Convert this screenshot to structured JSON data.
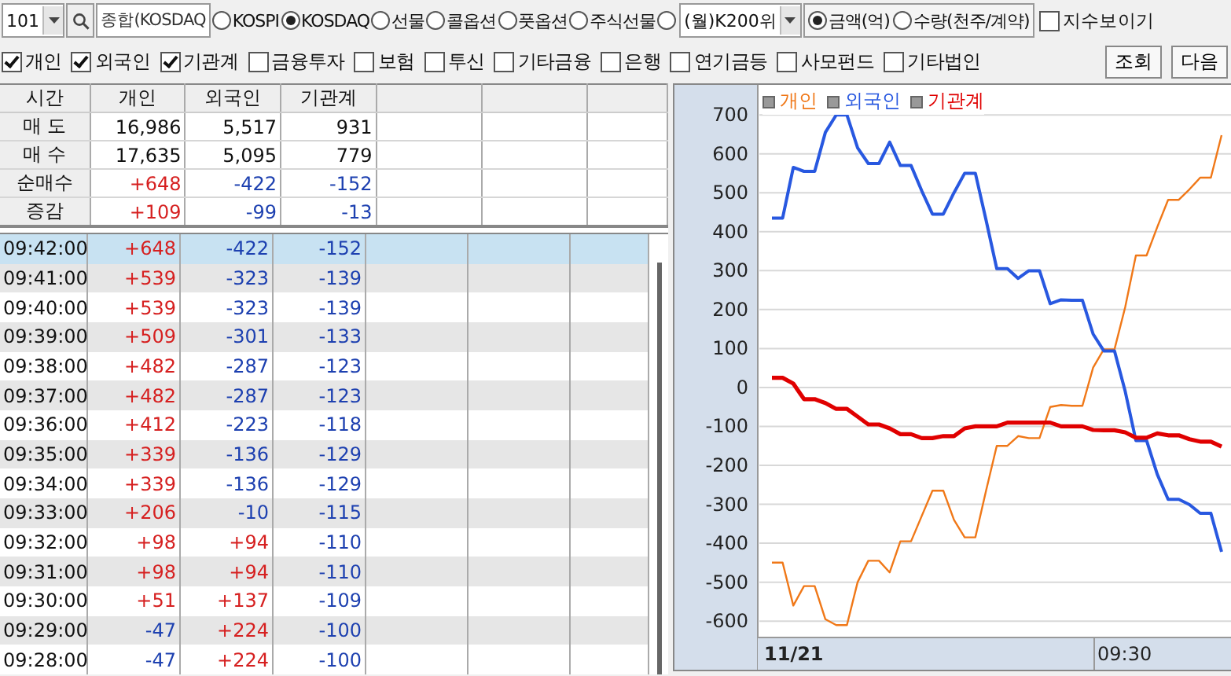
{
  "toolbar": {
    "code": "101",
    "market_field": "종합(KOSDAQ",
    "markets": [
      {
        "label": "KOSPI",
        "selected": false
      },
      {
        "label": "KOSDAQ",
        "selected": true
      },
      {
        "label": "선물",
        "selected": false
      },
      {
        "label": "콜옵션",
        "selected": false
      },
      {
        "label": "풋옵션",
        "selected": false
      },
      {
        "label": "주식선물",
        "selected": false
      },
      {
        "selected": false
      }
    ],
    "weekly_dropdown": "(월)K200위",
    "units": [
      {
        "label": "금액(억)",
        "selected": true
      },
      {
        "label": "수량(천주/계약)",
        "selected": false
      }
    ],
    "show_index": {
      "label": "지수보이기",
      "checked": false
    }
  },
  "filters": [
    {
      "label": "개인",
      "checked": true
    },
    {
      "label": "외국인",
      "checked": true
    },
    {
      "label": "기관계",
      "checked": true
    },
    {
      "label": "금융투자",
      "checked": false
    },
    {
      "label": "보험",
      "checked": false
    },
    {
      "label": "투신",
      "checked": false
    },
    {
      "label": "기타금융",
      "checked": false
    },
    {
      "label": "은행",
      "checked": false
    },
    {
      "label": "연기금등",
      "checked": false
    },
    {
      "label": "사모펀드",
      "checked": false
    },
    {
      "label": "기타법인",
      "checked": false
    }
  ],
  "buttons": [
    "조회",
    "다음"
  ],
  "summary": {
    "columns": [
      "시간",
      "개인",
      "외국인",
      "기관계"
    ],
    "rows": [
      {
        "cells": [
          {
            "text": "매 도",
            "color": "#111111"
          },
          {
            "text": "16,986",
            "color": "#111111"
          },
          {
            "text": "5,517",
            "color": "#111111"
          },
          {
            "text": "931",
            "color": "#111111"
          }
        ]
      },
      {
        "cells": [
          {
            "text": "매 수",
            "color": "#111111"
          },
          {
            "text": "17,635",
            "color": "#111111"
          },
          {
            "text": "5,095",
            "color": "#111111"
          },
          {
            "text": "779",
            "color": "#111111"
          }
        ]
      },
      {
        "cells": [
          {
            "text": "순매수",
            "color": "#111111"
          },
          {
            "text": "+648",
            "color": "#d62020"
          },
          {
            "text": "-422",
            "color": "#1d40b0"
          },
          {
            "text": "-152",
            "color": "#1d40b0"
          }
        ]
      },
      {
        "cells": [
          {
            "text": "증감",
            "color": "#111111"
          },
          {
            "text": "+109",
            "color": "#d62020"
          },
          {
            "text": "-99",
            "color": "#1d40b0"
          },
          {
            "text": "-13",
            "color": "#1d40b0"
          }
        ]
      }
    ]
  },
  "grid_rows": [
    {
      "selected": true,
      "cells": [
        {
          "text": "09:42:00",
          "color": "#111111"
        },
        {
          "text": "+648",
          "color": "#d62020"
        },
        {
          "text": "-422",
          "color": "#1d40b0"
        },
        {
          "text": "-152",
          "color": "#1d40b0"
        }
      ]
    },
    {
      "selected": false,
      "cells": [
        {
          "text": "09:41:00",
          "color": "#111111"
        },
        {
          "text": "+539",
          "color": "#d62020"
        },
        {
          "text": "-323",
          "color": "#1d40b0"
        },
        {
          "text": "-139",
          "color": "#1d40b0"
        }
      ]
    },
    {
      "selected": false,
      "cells": [
        {
          "text": "09:40:00",
          "color": "#111111"
        },
        {
          "text": "+539",
          "color": "#d62020"
        },
        {
          "text": "-323",
          "color": "#1d40b0"
        },
        {
          "text": "-139",
          "color": "#1d40b0"
        }
      ]
    },
    {
      "selected": false,
      "cells": [
        {
          "text": "09:39:00",
          "color": "#111111"
        },
        {
          "text": "+509",
          "color": "#d62020"
        },
        {
          "text": "-301",
          "color": "#1d40b0"
        },
        {
          "text": "-133",
          "color": "#1d40b0"
        }
      ]
    },
    {
      "selected": false,
      "cells": [
        {
          "text": "09:38:00",
          "color": "#111111"
        },
        {
          "text": "+482",
          "color": "#d62020"
        },
        {
          "text": "-287",
          "color": "#1d40b0"
        },
        {
          "text": "-123",
          "color": "#1d40b0"
        }
      ]
    },
    {
      "selected": false,
      "cells": [
        {
          "text": "09:37:00",
          "color": "#111111"
        },
        {
          "text": "+482",
          "color": "#d62020"
        },
        {
          "text": "-287",
          "color": "#1d40b0"
        },
        {
          "text": "-123",
          "color": "#1d40b0"
        }
      ]
    },
    {
      "selected": false,
      "cells": [
        {
          "text": "09:36:00",
          "color": "#111111"
        },
        {
          "text": "+412",
          "color": "#d62020"
        },
        {
          "text": "-223",
          "color": "#1d40b0"
        },
        {
          "text": "-118",
          "color": "#1d40b0"
        }
      ]
    },
    {
      "selected": false,
      "cells": [
        {
          "text": "09:35:00",
          "color": "#111111"
        },
        {
          "text": "+339",
          "color": "#d62020"
        },
        {
          "text": "-136",
          "color": "#1d40b0"
        },
        {
          "text": "-129",
          "color": "#1d40b0"
        }
      ]
    },
    {
      "selected": false,
      "cells": [
        {
          "text": "09:34:00",
          "color": "#111111"
        },
        {
          "text": "+339",
          "color": "#d62020"
        },
        {
          "text": "-136",
          "color": "#1d40b0"
        },
        {
          "text": "-129",
          "color": "#1d40b0"
        }
      ]
    },
    {
      "selected": false,
      "cells": [
        {
          "text": "09:33:00",
          "color": "#111111"
        },
        {
          "text": "+206",
          "color": "#d62020"
        },
        {
          "text": "-10",
          "color": "#1d40b0"
        },
        {
          "text": "-115",
          "color": "#1d40b0"
        }
      ]
    },
    {
      "selected": false,
      "cells": [
        {
          "text": "09:32:00",
          "color": "#111111"
        },
        {
          "text": "+98",
          "color": "#d62020"
        },
        {
          "text": "+94",
          "color": "#d62020"
        },
        {
          "text": "-110",
          "color": "#1d40b0"
        }
      ]
    },
    {
      "selected": false,
      "cells": [
        {
          "text": "09:31:00",
          "color": "#111111"
        },
        {
          "text": "+98",
          "color": "#d62020"
        },
        {
          "text": "+94",
          "color": "#d62020"
        },
        {
          "text": "-110",
          "color": "#1d40b0"
        }
      ]
    },
    {
      "selected": false,
      "cells": [
        {
          "text": "09:30:00",
          "color": "#111111"
        },
        {
          "text": "+51",
          "color": "#d62020"
        },
        {
          "text": "+137",
          "color": "#d62020"
        },
        {
          "text": "-109",
          "color": "#1d40b0"
        }
      ]
    },
    {
      "selected": false,
      "cells": [
        {
          "text": "09:29:00",
          "color": "#111111"
        },
        {
          "text": "-47",
          "color": "#1d40b0"
        },
        {
          "text": "+224",
          "color": "#d62020"
        },
        {
          "text": "-100",
          "color": "#1d40b0"
        }
      ]
    },
    {
      "selected": false,
      "cells": [
        {
          "text": "09:28:00",
          "color": "#111111"
        },
        {
          "text": "-47",
          "color": "#1d40b0"
        },
        {
          "text": "+224",
          "color": "#d62020"
        },
        {
          "text": "-100",
          "color": "#1d40b0"
        }
      ]
    }
  ],
  "chart": {
    "date_label": "11/21",
    "chart_data": {
      "type": "line",
      "series": [
        {
          "name": "개인",
          "color": "#f07818",
          "values": [
            -450,
            -450,
            -560,
            -510,
            -510,
            -595,
            -610,
            -610,
            -500,
            -445,
            -445,
            -475,
            -395,
            -395,
            -330,
            -265,
            -265,
            -340,
            -385,
            -385,
            -265,
            -150,
            -150,
            -125,
            -130,
            -130,
            -50,
            -45,
            -47,
            -47,
            51,
            98,
            98,
            206,
            339,
            339,
            412,
            482,
            482,
            509,
            539,
            539,
            648
          ]
        },
        {
          "name": "외국인",
          "color": "#2858e0",
          "values": [
            435,
            435,
            565,
            555,
            555,
            655,
            700,
            700,
            615,
            575,
            575,
            630,
            570,
            570,
            505,
            445,
            445,
            500,
            550,
            550,
            430,
            305,
            305,
            280,
            300,
            300,
            215,
            225,
            224,
            224,
            137,
            94,
            94,
            -10,
            -136,
            -136,
            -223,
            -287,
            -287,
            -301,
            -323,
            -323,
            -422
          ]
        },
        {
          "name": "기관계",
          "color": "#e00000",
          "values": [
            25,
            25,
            10,
            -30,
            -30,
            -40,
            -55,
            -55,
            -75,
            -95,
            -95,
            -105,
            -120,
            -120,
            -130,
            -130,
            -125,
            -125,
            -105,
            -100,
            -100,
            -100,
            -90,
            -90,
            -90,
            -90,
            -90,
            -100,
            -100,
            -100,
            -109,
            -110,
            -110,
            -115,
            -129,
            -129,
            -118,
            -123,
            -123,
            -133,
            -139,
            -139,
            -152
          ]
        }
      ],
      "ylim": [
        -640,
        777
      ],
      "yticks": [
        -600,
        -500,
        -400,
        -300,
        -200,
        -100,
        0,
        100,
        200,
        300,
        400,
        500,
        600,
        700
      ],
      "annotations": [
        "09:30"
      ],
      "grid": true
    }
  }
}
